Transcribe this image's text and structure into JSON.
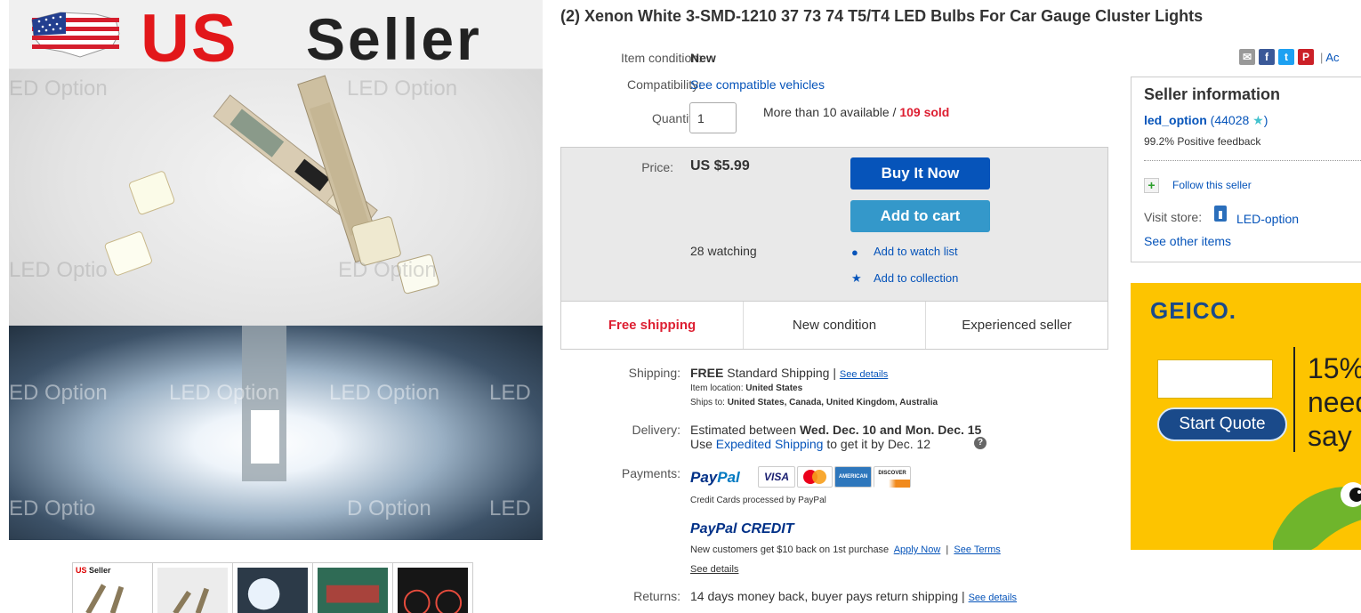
{
  "hero": {
    "banner_us": "US",
    "banner_seller": "Seller",
    "watermark": "LED Option",
    "watermark_short": "LED",
    "watermark_cut": "LED Optio",
    "watermark_cut_left": "ED Option",
    "watermark_cut_left2": "ED Optio",
    "watermark_cut_mid": "D Option",
    "thumb_us": "US",
    "thumb_seller": "Seller"
  },
  "listing": {
    "title": "(2) Xenon White 3-SMD-1210 37 73 74 T5/T4 LED Bulbs For Car Gauge Cluster Lights",
    "condition_label": "Item condition:",
    "condition_value": "New",
    "compat_label": "Compatibility:",
    "compat_link": "See compatible vehicles",
    "qty_label": "Quantity:",
    "qty_value": "1",
    "avail_text": "More than 10 available /",
    "sold_text": "109 sold"
  },
  "buybox": {
    "price_label": "Price:",
    "price_value": "US $5.99",
    "buy_now": "Buy It Now",
    "add_cart": "Add to cart",
    "watching": "28 watching",
    "watch_list": "Add to watch list",
    "collection": "Add to collection",
    "strip": [
      "Free shipping",
      "New condition",
      "Experienced seller"
    ]
  },
  "shipping": {
    "label": "Shipping:",
    "free": "FREE",
    "method": "Standard Shipping |",
    "details": "See details",
    "location_label": "Item location:",
    "location_value": "United States",
    "ships_label": "Ships to:",
    "ships_value": "United States, Canada, United Kingdom, Australia"
  },
  "delivery": {
    "label": "Delivery:",
    "line1_prefix": "Estimated between",
    "line1_dates": "Wed. Dec. 10 and Mon. Dec. 15",
    "line2_prefix": "Use",
    "line2_link": "Expedited Shipping",
    "line2_suffix": "to get it by Dec. 12"
  },
  "payments": {
    "label": "Payments:",
    "paypal_1": "Pay",
    "paypal_2": "Pal",
    "cards": [
      "VISA",
      "MasterCard",
      "AMERICAN EXPRESS",
      "DISCOVER"
    ],
    "processed": "Credit Cards processed by PayPal",
    "credit_1": "PayPal",
    "credit_2": "CREDIT",
    "credit_text": "New customers get $10 back on 1st purchase",
    "apply_now": "Apply Now",
    "sep": "|",
    "see_terms": "See Terms",
    "see_details": "See details"
  },
  "returns": {
    "label": "Returns:",
    "text": "14 days money back, buyer pays return shipping |",
    "details": "See details"
  },
  "share": {
    "sep": "|",
    "add": "Ac"
  },
  "seller": {
    "heading": "Seller information",
    "name": "led_option",
    "feedback": "44028",
    "positive": "99.2% Positive feedback",
    "follow": "Follow this seller",
    "visit": "Visit store:",
    "store": "LED-option",
    "other": "See other items"
  },
  "ad": {
    "logo": "GEICO.",
    "button": "Start Quote",
    "line1": "15%",
    "line2": "need",
    "line3": "say r"
  },
  "colors": {
    "link": "#0654ba",
    "buy_button": "#0654ba",
    "cart_button": "#3498ca",
    "red": "#dd1e31",
    "geico_yellow": "#fdc400"
  }
}
